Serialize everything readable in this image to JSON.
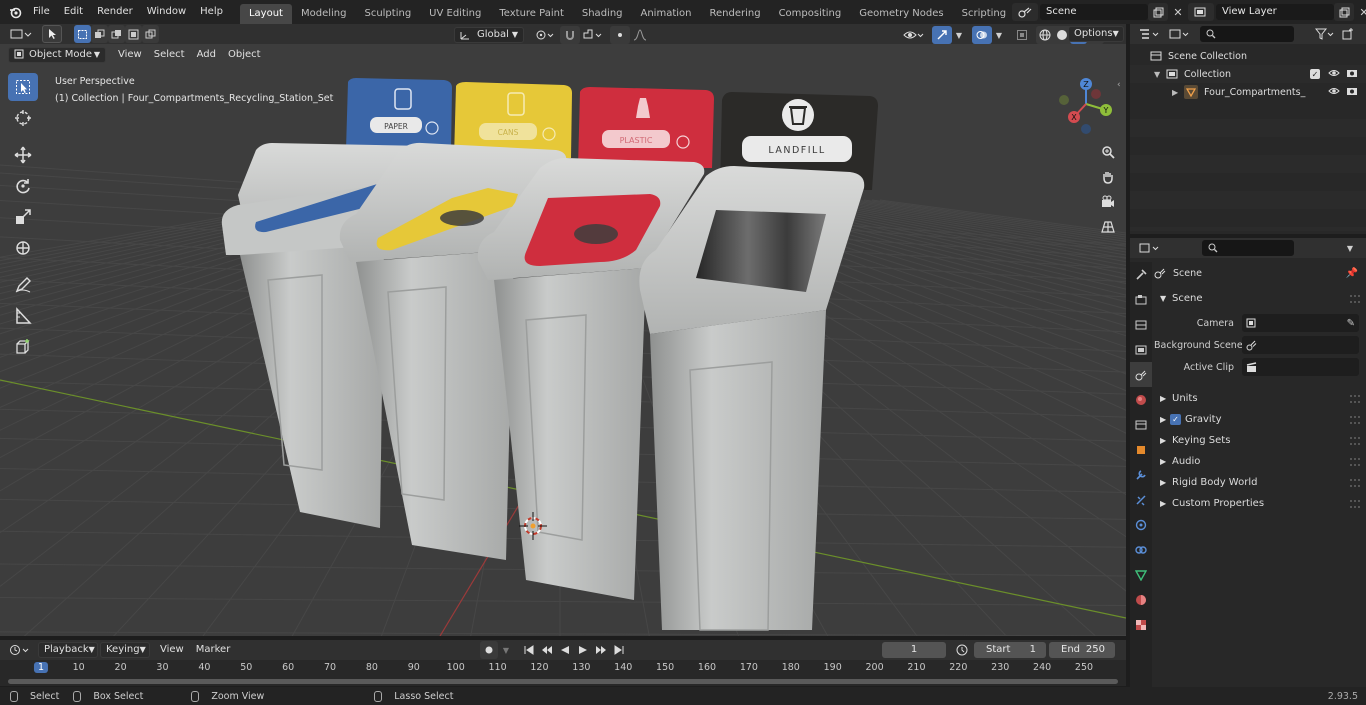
{
  "topbar": {
    "menus": [
      "File",
      "Edit",
      "Render",
      "Window",
      "Help"
    ],
    "workspaces": [
      "Layout",
      "Modeling",
      "Sculpting",
      "UV Editing",
      "Texture Paint",
      "Shading",
      "Animation",
      "Rendering",
      "Compositing",
      "Geometry Nodes",
      "Scripting"
    ],
    "active_workspace": "Layout",
    "add_tab": "+",
    "scene_name": "Scene",
    "view_layer": "View Layer"
  },
  "viewport_header": {
    "mode": "Object Mode",
    "menus": [
      "View",
      "Select",
      "Add",
      "Object"
    ],
    "orientation": "Global",
    "options": "Options"
  },
  "viewport": {
    "perspective": "User Perspective",
    "collection_info": "(1) Collection | Four_Compartments_Recycling_Station_Set",
    "bins": [
      {
        "label": "PAPER",
        "color": "#3b66a8"
      },
      {
        "label": "CANS",
        "color": "#e6c838"
      },
      {
        "label": "PLASTIC",
        "color": "#cf2e3e"
      },
      {
        "label": "LANDFILL",
        "color": "#2b2a28"
      }
    ],
    "gizmo": {
      "x": "X",
      "y": "Y",
      "z": "Z"
    }
  },
  "outliner": {
    "scene_collection": "Scene Collection",
    "collection": "Collection",
    "object": "Four_Compartments_Rec"
  },
  "properties": {
    "context": "Scene",
    "panel": "Scene",
    "camera_label": "Camera",
    "background_label": "Background Scene",
    "clip_label": "Active Clip",
    "sections": [
      "Units",
      "Gravity",
      "Keying Sets",
      "Audio",
      "Rigid Body World",
      "Custom Properties"
    ],
    "gravity_checked": true
  },
  "timeline": {
    "menus": [
      "Playback",
      "Keying",
      "View",
      "Marker"
    ],
    "current_frame": "1",
    "start_label": "Start",
    "start": "1",
    "end_label": "End",
    "end": "250",
    "ticks": [
      "1",
      "10",
      "20",
      "30",
      "40",
      "50",
      "60",
      "70",
      "80",
      "90",
      "100",
      "110",
      "120",
      "130",
      "140",
      "150",
      "160",
      "170",
      "180",
      "190",
      "200",
      "210",
      "220",
      "230",
      "240",
      "250"
    ]
  },
  "statusbar": {
    "select": "Select",
    "box_select": "Box Select",
    "zoom_view": "Zoom View",
    "lasso_select": "Lasso Select",
    "version": "2.93.5"
  }
}
